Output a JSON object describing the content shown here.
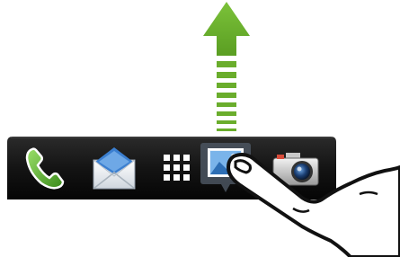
{
  "gesture": {
    "direction": "up",
    "arrow_color": "#6aad2c",
    "finger_icon": "hand-finger-icon"
  },
  "dock": {
    "background_color": "#141414",
    "items": [
      {
        "icon": "phone-icon",
        "accent": "#5cb531"
      },
      {
        "icon": "mail-icon",
        "accent": "#3b7fd0"
      },
      {
        "icon": "app-grid-icon",
        "accent": "#ffffff"
      },
      {
        "icon": "gallery-icon",
        "accent": "#4a8fd4",
        "selected": true
      },
      {
        "icon": "camera-icon",
        "accent": "#d9d9d9"
      }
    ]
  }
}
